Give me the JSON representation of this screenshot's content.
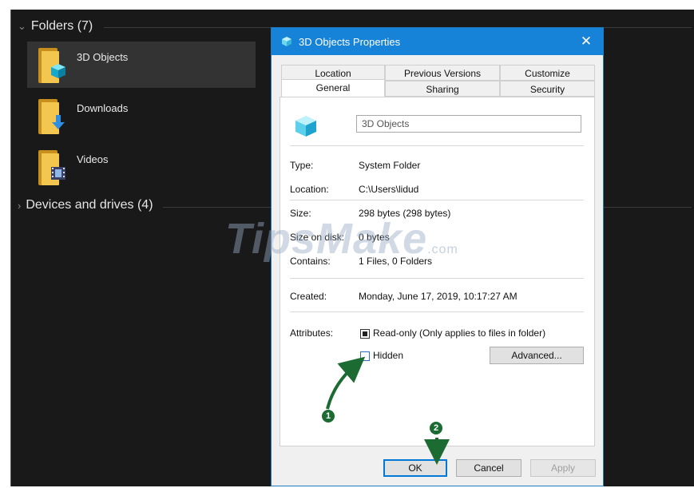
{
  "explorer": {
    "folders_header": "Folders (7)",
    "devices_header": "Devices and drives (4)",
    "items": [
      {
        "label": "3D Objects",
        "icon": "3d-objects-folder-icon"
      },
      {
        "label": "Downloads",
        "icon": "downloads-folder-icon"
      },
      {
        "label": "Videos",
        "icon": "videos-folder-icon"
      }
    ]
  },
  "dialog": {
    "title": "3D Objects Properties",
    "close_glyph": "✕",
    "tabs_row1": [
      "Location",
      "Previous Versions",
      "Customize"
    ],
    "tabs_row2": [
      "General",
      "Sharing",
      "Security"
    ],
    "active_tab": "General",
    "name_value": "3D Objects",
    "properties": [
      {
        "label": "Type:",
        "value": "System Folder"
      },
      {
        "label": "Location:",
        "value": "C:\\Users\\lidud"
      },
      {
        "label": "Size:",
        "value": "298 bytes (298 bytes)"
      },
      {
        "label": "Size on disk:",
        "value": "0 bytes"
      },
      {
        "label": "Contains:",
        "value": "1 Files, 0 Folders"
      },
      {
        "label": "Created:",
        "value": "Monday, June 17, 2019, 10:17:27 AM"
      }
    ],
    "attributes_label": "Attributes:",
    "readonly_label": "Read-only (Only applies to files in folder)",
    "hidden_label": "Hidden",
    "advanced_label": "Advanced...",
    "ok_label": "OK",
    "cancel_label": "Cancel",
    "apply_label": "Apply"
  },
  "annotations": {
    "step1": "1",
    "step2": "2"
  },
  "watermark": {
    "main": "TipsMake",
    "suffix": ".com"
  },
  "colors": {
    "titlebar": "#1683d8",
    "explorer_bg": "#191919",
    "folder_yellow": "#f3c64f",
    "annotation_green": "#1c6b33"
  }
}
